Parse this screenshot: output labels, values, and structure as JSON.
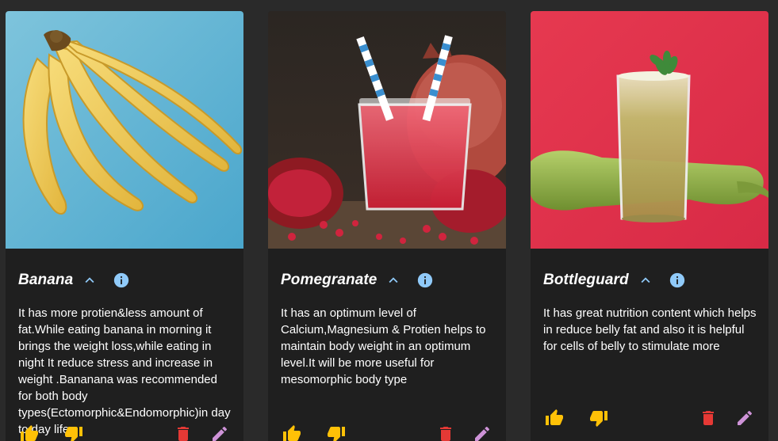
{
  "colors": {
    "page_bg": "#2a2a2a",
    "card_bg": "#1f1f1f",
    "title": "#ffffff",
    "info_icon": "#90caf9",
    "like_icon": "#ffc107",
    "delete_icon": "#e53935",
    "edit_icon": "#ce93d8"
  },
  "cards": [
    {
      "title": "Banana",
      "description": "It has more protien&less amount of fat.While eating banana in morning it brings the weight loss,while eating in night It reduce stress and increase in weight .Bananana was recommended for both body types(Ectomorphic&Endomorphic)in day to day life.",
      "icons": [
        "chevron-up-icon",
        "info-icon",
        "thumb-up-icon",
        "thumb-down-icon",
        "trash-icon",
        "pencil-icon"
      ]
    },
    {
      "title": "Pomegranate",
      "description": "It has an optimum level of Calcium,Magnesium & Protien helps to maintain body weight in an optimum level.It will be more useful for mesomorphic body type",
      "icons": [
        "chevron-up-icon",
        "info-icon",
        "thumb-up-icon",
        "thumb-down-icon",
        "trash-icon",
        "pencil-icon"
      ]
    },
    {
      "title": "Bottleguard",
      "description": "It has great nutrition content which helps in reduce belly fat and also it is helpful for cells of belly to stimulate more",
      "icons": [
        "chevron-up-icon",
        "info-icon",
        "thumb-up-icon",
        "thumb-down-icon",
        "trash-icon",
        "pencil-icon"
      ]
    }
  ]
}
